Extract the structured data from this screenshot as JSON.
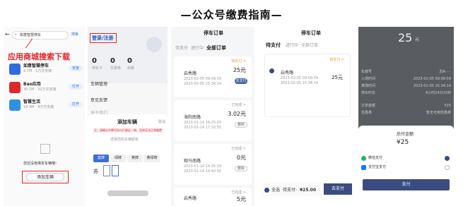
{
  "page": {
    "title": "—公众号缴费指南—"
  },
  "panel1": {
    "search_value": "如意智慧停车",
    "search_button": "搜索",
    "red_label": "应用商城搜索下载",
    "apps": [
      {
        "name": "如意智慧停车",
        "desc": "4.7M · 1万次安装",
        "button": "安装",
        "color": "#2f6be0"
      },
      {
        "name": "Bao应用",
        "desc": "30.1M · 32万次安装",
        "button": "打开",
        "color": "#e0262b"
      },
      {
        "name": "智慧生活",
        "desc": "18.4M · 8万次安装",
        "button": "打开",
        "color": "#2f8fe0"
      }
    ],
    "empty_text": "您还没有绑定车辆哦!",
    "add_vehicle_button": "添加车辆"
  },
  "panel2": {
    "login_label": "登录/注册",
    "stats": [
      {
        "value": "0",
        "label": "停车卡"
      },
      {
        "value": "0",
        "label": "优惠券"
      },
      {
        "value": "0",
        "label": "余额"
      }
    ],
    "menu": [
      "车辆管理",
      "意见反馈",
      "关于我们"
    ],
    "sheet_title": "添加车辆",
    "sheet_close": "取消",
    "sheet_notice": "注：请确认车牌号码与行驶证一致，否则无法正常缴费",
    "color_title": "选择您的车辆颜色",
    "colors": [
      "蓝牌",
      "绿牌",
      "黄牌",
      "黄绿牌"
    ],
    "plate_prefix": "苏"
  },
  "panel3": {
    "title": "停车订单",
    "tabs": [
      "待支付",
      "进行中",
      "全部订单"
    ],
    "orders": [
      {
        "status": "待支付 >",
        "lot": "启秀路",
        "start": "2023-02-05 09:09:59",
        "end": "2023-02-05 15:34:14",
        "amount": "25元",
        "button": "去支付"
      },
      {
        "status": "已完成 >",
        "lot": "海阳南路",
        "start": "2023-01-14 16:25:03",
        "end": "2023-01-14 17:32:55",
        "amount": "3.02元",
        "button": "删除"
      },
      {
        "status": "已完成 >",
        "lot": "观马南路",
        "start": "2023-01-14 14:25:19",
        "end": "2023-01-14 14:40:02",
        "amount": "0元",
        "button": "删除"
      },
      {
        "status": "已完成 >",
        "lot": "启秀路",
        "start": "",
        "end": "",
        "amount": "5元",
        "button": ""
      }
    ]
  },
  "panel4": {
    "title": "停车订单",
    "tabs": [
      "待支付",
      "进行中",
      "全部订单"
    ],
    "order": {
      "status": "待支付 >",
      "lot": "启秀路",
      "start": "2023-02-05 09:09:59",
      "end": "2023-02-05 15:34:14",
      "amount": "25元"
    },
    "select_all": "全选",
    "total_label": "待支付:",
    "total": "¥25.00",
    "pay_button": "去支付"
  },
  "panel5": {
    "amount": "25",
    "unit": "元",
    "details": [
      {
        "label": "车牌号",
        "value": "苏A·····"
      },
      {
        "label": "入场时间",
        "value": "2023-02-05 09:09:59"
      },
      {
        "label": "离场时间",
        "value": "2023-02-05 15:34:14"
      },
      {
        "label": "停车时长",
        "value": "6小时24分15秒"
      },
      {
        "label": "订单金额",
        "value": "¥25"
      },
      {
        "label": "优惠券",
        "value": "暂无可用优惠券"
      }
    ],
    "sheet_title": "后付金额",
    "sheet_amount": "¥25",
    "methods": [
      {
        "name": "微信支付",
        "selected": true
      },
      {
        "name": "支付宝支付",
        "selected": false
      }
    ],
    "pay_button": "支付"
  }
}
